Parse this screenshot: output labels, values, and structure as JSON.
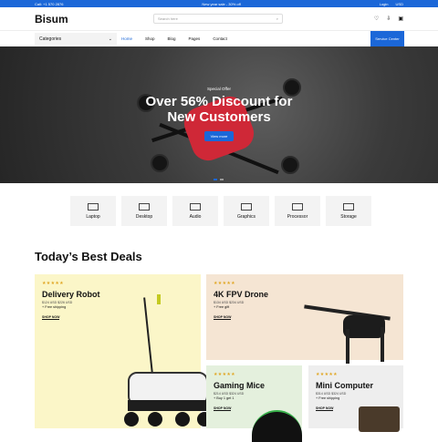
{
  "topbar": {
    "phone": "Call: +1 570 2876",
    "promo": "New year sale - 30% off",
    "login": "Login",
    "currency": "USD"
  },
  "header": {
    "logo": "Bisum",
    "search_placeholder": "Search here"
  },
  "nav": {
    "categories": "Categories",
    "items": [
      "Home",
      "Shop",
      "Blog",
      "Pages",
      "Contact"
    ],
    "service": "Service Center"
  },
  "hero": {
    "eyebrow": "Special Offer",
    "title_line1": "Over 56% Discount for",
    "title_line2": "New Customers",
    "button": "View more"
  },
  "categories": [
    "Laptop",
    "Desktop",
    "Audio",
    "Graphics",
    "Processor",
    "Storage"
  ],
  "deals": {
    "title": "Today’s Best Deals",
    "items": [
      {
        "name": "Delivery Robot",
        "price": "$124 USD  $226 USD",
        "note": "+ Free shipping",
        "cta": "SHOP NOW",
        "stars": "★★★★★"
      },
      {
        "name": "4K FPV Drone",
        "price": "$134 USD  $234 USD",
        "note": "+ Free gift",
        "cta": "SHOP NOW",
        "stars": "★★★★★"
      },
      {
        "name": "Gaming Mice",
        "price": "$214 USD  $324 USD",
        "note": "+ Buy 1 get 1",
        "cta": "SHOP NOW",
        "stars": "★★★★★"
      },
      {
        "name": "Mini Computer",
        "price": "$314 USD  $324 USD",
        "note": "+ Free shipping",
        "cta": "SHOP NOW",
        "stars": "★★★★★"
      }
    ]
  },
  "colors": {
    "accent": "#1b67d8",
    "robot_card": "#fbf6c8",
    "drone_card": "#f5e5d3",
    "mice_card": "#e4f0dd",
    "mini_card": "#eeeeee"
  }
}
